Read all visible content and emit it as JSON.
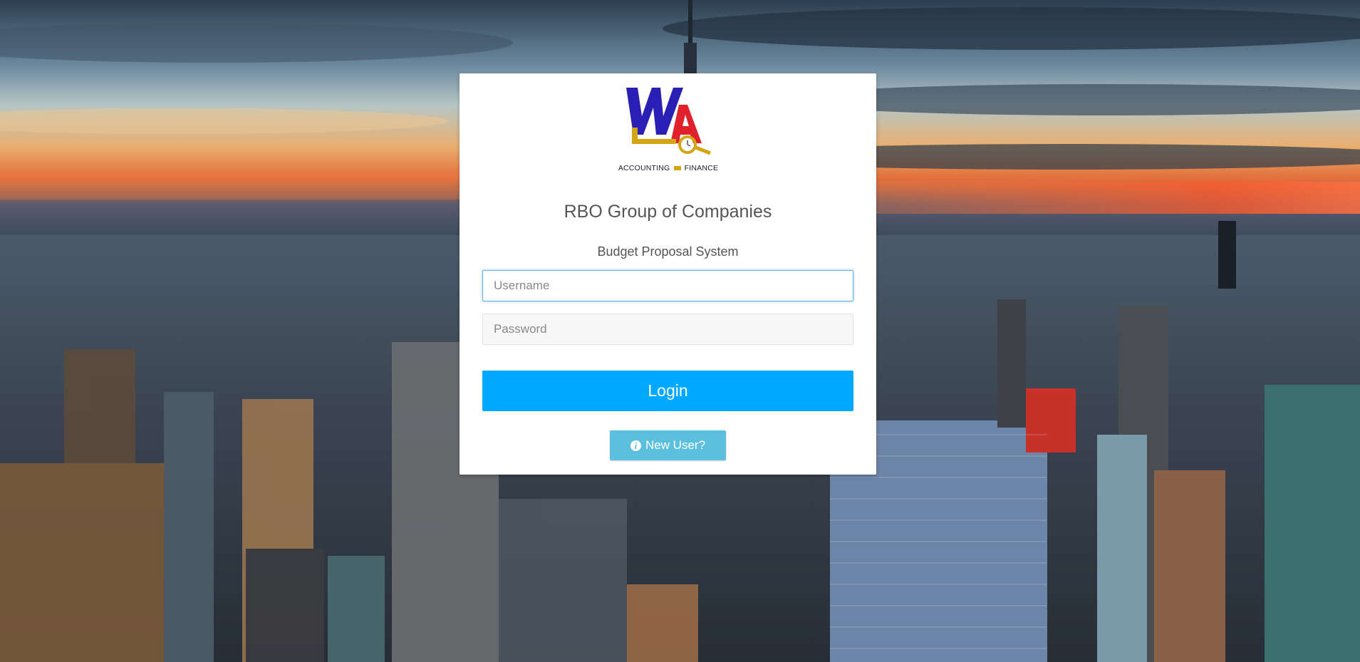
{
  "organization": {
    "title": "RBO Group of Companies",
    "system_name": "Budget Proposal System"
  },
  "logo": {
    "caption_left": "ACCOUNTING",
    "caption_right": "FINANCE",
    "icon": "wa-accounting-finance-logo"
  },
  "form": {
    "username_placeholder": "Username",
    "username_value": "",
    "password_placeholder": "Password",
    "password_value": "",
    "login_label": "Login",
    "new_user_label": "New User?",
    "new_user_icon": "info-circle-icon"
  },
  "colors": {
    "login_button": "#00a8ff",
    "new_user_button": "#5bc0de",
    "focus_border": "#66afe9",
    "text": "#555555"
  }
}
